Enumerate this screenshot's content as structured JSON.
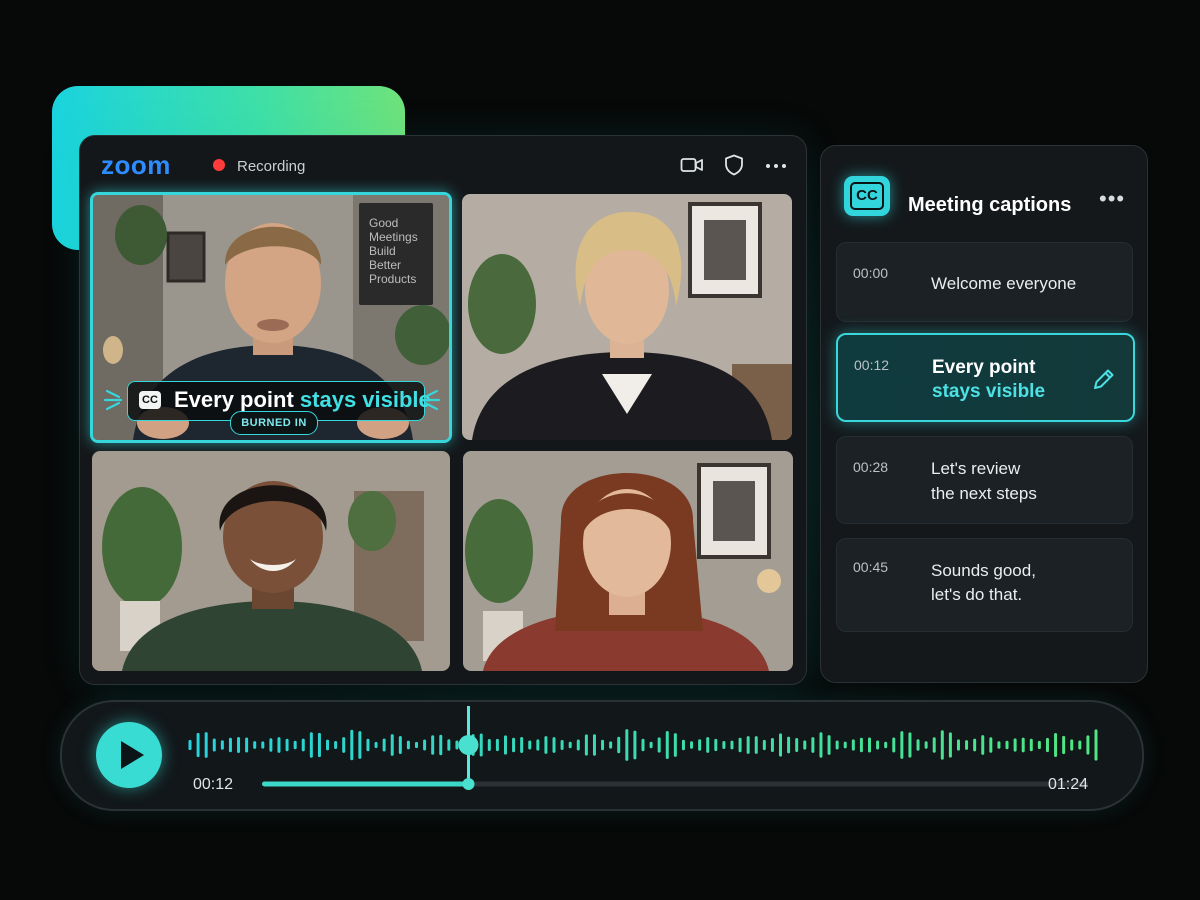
{
  "app": {
    "logo": "zoom",
    "recording_label": "Recording",
    "recording_color": "#ff3b3b",
    "accent_color": "#35d7dc",
    "toolbar_icons": [
      "video-camera-icon",
      "shield-icon",
      "more-options-icon"
    ]
  },
  "video_grid": {
    "participants": [
      {
        "id": "participant-1",
        "active": true
      },
      {
        "id": "participant-2",
        "active": false
      },
      {
        "id": "participant-3",
        "active": false
      },
      {
        "id": "participant-4",
        "active": false
      }
    ],
    "poster_text": [
      "Good",
      "Meetings",
      "Build",
      "Better",
      "Products"
    ],
    "burned_caption": {
      "cc_label": "CC",
      "text_plain": "Every point ",
      "text_highlight": "stays visible",
      "badge": "BURNED IN"
    }
  },
  "captions_panel": {
    "cc_label": "CC",
    "title": "Meeting captions",
    "more": "•••",
    "items": [
      {
        "time": "00:00",
        "line1": "Welcome everyone",
        "line2": ""
      },
      {
        "time": "00:12",
        "line1": "Every point",
        "line2": "stays visible",
        "active": true
      },
      {
        "time": "00:28",
        "line1": "Let's review",
        "line2": "the next steps"
      },
      {
        "time": "00:45",
        "line1": "Sounds good,",
        "line2": "let's do that."
      }
    ]
  },
  "player": {
    "current_time": "00:12",
    "total_time": "01:24",
    "progress": 0.25
  }
}
